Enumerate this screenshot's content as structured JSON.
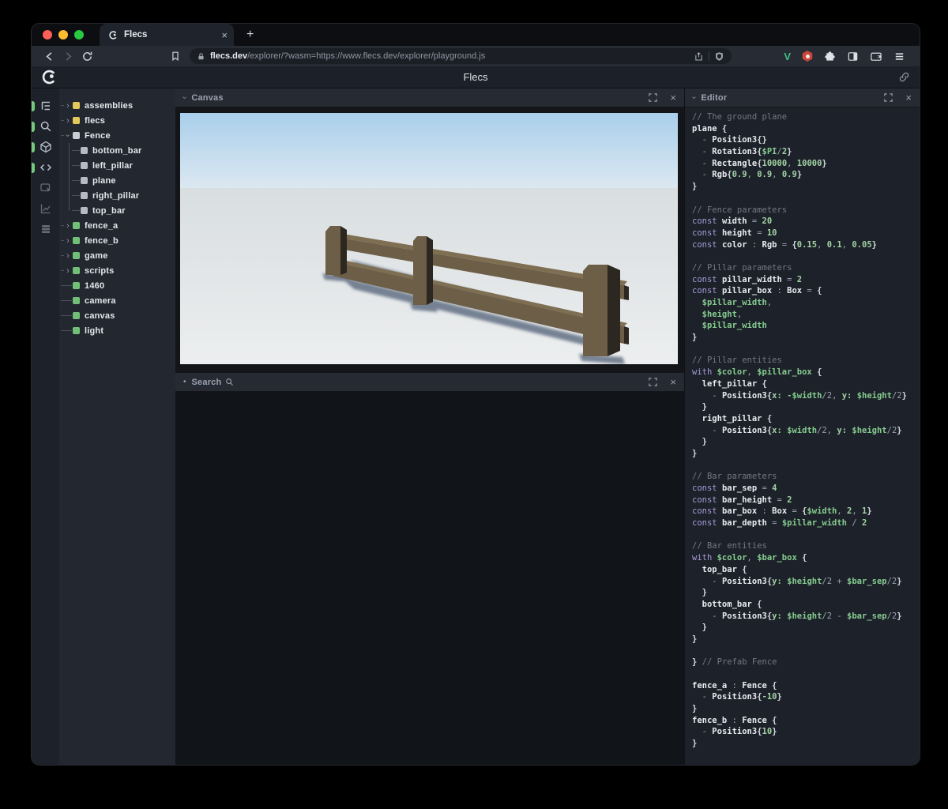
{
  "window_controls": {
    "close_color": "#ff5f57",
    "minimize_color": "#febc2e",
    "zoom_color": "#28c840"
  },
  "browser": {
    "tab": {
      "title": "Flecs"
    },
    "url": {
      "domain": "flecs.dev",
      "path": "/explorer/?wasm=https://www.flecs.dev/explorer/playground.js"
    },
    "extensions": {
      "v_label": "V",
      "v_color": "#40bd83",
      "badge_color": "#c9453c"
    }
  },
  "header": {
    "title": "Flecs"
  },
  "icons": {
    "close": "×",
    "plus": "+",
    "chevron": "›",
    "dot": "•"
  },
  "toolstrip": {
    "active_color": "#74c97c",
    "items": [
      {
        "name": "entity-tree",
        "icon": "hierarchy",
        "active": true
      },
      {
        "name": "query-search",
        "icon": "search",
        "active": true
      },
      {
        "name": "canvas-3d",
        "icon": "cube",
        "active": true
      },
      {
        "name": "script-editor",
        "icon": "code",
        "active": true
      },
      {
        "name": "inspector",
        "icon": "inspect",
        "active": false
      },
      {
        "name": "statistics",
        "icon": "chart",
        "active": false
      },
      {
        "name": "tables",
        "icon": "rows",
        "active": false
      }
    ]
  },
  "tree": {
    "colors": {
      "module": "#e3c85a",
      "prefab": "#c9ced5",
      "child": "#b4bbc3",
      "entity": "#72c077"
    },
    "items": [
      {
        "label": "assemblies",
        "kind": "module",
        "arrow": "collapsed",
        "depth": 0
      },
      {
        "label": "flecs",
        "kind": "module",
        "arrow": "collapsed",
        "depth": 0
      },
      {
        "label": "Fence",
        "kind": "prefab",
        "arrow": "expanded",
        "depth": 0
      },
      {
        "label": "bottom_bar",
        "kind": "child",
        "arrow": "child",
        "depth": 1
      },
      {
        "label": "left_pillar",
        "kind": "child",
        "arrow": "child",
        "depth": 1
      },
      {
        "label": "plane",
        "kind": "child",
        "arrow": "child",
        "depth": 1
      },
      {
        "label": "right_pillar",
        "kind": "child",
        "arrow": "child",
        "depth": 1
      },
      {
        "label": "top_bar",
        "kind": "child",
        "arrow": "child",
        "depth": 1
      },
      {
        "label": "fence_a",
        "kind": "entity",
        "arrow": "collapsed",
        "depth": 0
      },
      {
        "label": "fence_b",
        "kind": "entity",
        "arrow": "collapsed",
        "depth": 0
      },
      {
        "label": "game",
        "kind": "entity",
        "arrow": "collapsed",
        "depth": 0
      },
      {
        "label": "scripts",
        "kind": "entity",
        "arrow": "collapsed",
        "depth": 0
      },
      {
        "label": "1460",
        "kind": "entity",
        "arrow": "leaf",
        "depth": 0
      },
      {
        "label": "camera",
        "kind": "entity",
        "arrow": "leaf",
        "depth": 0
      },
      {
        "label": "canvas",
        "kind": "entity",
        "arrow": "leaf",
        "depth": 0
      },
      {
        "label": "light",
        "kind": "entity",
        "arrow": "leaf",
        "depth": 0
      }
    ]
  },
  "panels": {
    "canvas": {
      "title": "Canvas"
    },
    "search": {
      "title": "Search"
    },
    "editor": {
      "title": "Editor"
    }
  },
  "scene": {
    "sky_top": "#a9cfeb",
    "sky_horizon": "#dce8f1",
    "ground_far": "#d9dee0",
    "ground_near": "#eceeef",
    "wood_front": "#6c5e47",
    "wood_top": "#7e6e52",
    "wood_side": "#2c2720",
    "shadow": "#5d6c80"
  },
  "code": {
    "lines": [
      [
        [
          "c",
          "// The ground plane"
        ]
      ],
      [
        [
          "i",
          "plane"
        ],
        [
          "b",
          " {"
        ]
      ],
      [
        [
          "p",
          "  - "
        ],
        [
          "i",
          "Position3"
        ],
        [
          "b",
          "{}"
        ]
      ],
      [
        [
          "p",
          "  - "
        ],
        [
          "i",
          "Rotation3"
        ],
        [
          "b",
          "{"
        ],
        [
          "v",
          "$PI"
        ],
        [
          "p",
          "/"
        ],
        [
          "n",
          "2"
        ],
        [
          "b",
          "}"
        ]
      ],
      [
        [
          "p",
          "  - "
        ],
        [
          "i",
          "Rectangle"
        ],
        [
          "b",
          "{"
        ],
        [
          "n",
          "10000"
        ],
        [
          "p",
          ", "
        ],
        [
          "n",
          "10000"
        ],
        [
          "b",
          "}"
        ]
      ],
      [
        [
          "p",
          "  - "
        ],
        [
          "i",
          "Rgb"
        ],
        [
          "b",
          "{"
        ],
        [
          "n",
          "0.9"
        ],
        [
          "p",
          ", "
        ],
        [
          "n",
          "0.9"
        ],
        [
          "p",
          ", "
        ],
        [
          "n",
          "0.9"
        ],
        [
          "b",
          "}"
        ]
      ],
      [
        [
          "b",
          "}"
        ]
      ],
      [],
      [
        [
          "c",
          "// Fence parameters"
        ]
      ],
      [
        [
          "k",
          "const "
        ],
        [
          "i",
          "width"
        ],
        [
          "p",
          " = "
        ],
        [
          "n",
          "20"
        ]
      ],
      [
        [
          "k",
          "const "
        ],
        [
          "i",
          "height"
        ],
        [
          "p",
          " = "
        ],
        [
          "n",
          "10"
        ]
      ],
      [
        [
          "k",
          "const "
        ],
        [
          "i",
          "color"
        ],
        [
          "p",
          " : "
        ],
        [
          "i",
          "Rgb"
        ],
        [
          "p",
          " = "
        ],
        [
          "b",
          "{"
        ],
        [
          "n",
          "0.15"
        ],
        [
          "p",
          ", "
        ],
        [
          "n",
          "0.1"
        ],
        [
          "p",
          ", "
        ],
        [
          "n",
          "0.05"
        ],
        [
          "b",
          "}"
        ]
      ],
      [],
      [
        [
          "c",
          "// Pillar parameters"
        ]
      ],
      [
        [
          "k",
          "const "
        ],
        [
          "i",
          "pillar_width"
        ],
        [
          "p",
          " = "
        ],
        [
          "n",
          "2"
        ]
      ],
      [
        [
          "k",
          "const "
        ],
        [
          "i",
          "pillar_box"
        ],
        [
          "p",
          " : "
        ],
        [
          "i",
          "Box"
        ],
        [
          "p",
          " = "
        ],
        [
          "b",
          "{"
        ]
      ],
      [
        [
          "v",
          "  $pillar_width"
        ],
        [
          "p",
          ","
        ]
      ],
      [
        [
          "v",
          "  $height"
        ],
        [
          "p",
          ","
        ]
      ],
      [
        [
          "v",
          "  $pillar_width"
        ]
      ],
      [
        [
          "b",
          "}"
        ]
      ],
      [],
      [
        [
          "c",
          "// Pillar entities"
        ]
      ],
      [
        [
          "k",
          "with "
        ],
        [
          "v",
          "$color"
        ],
        [
          "p",
          ", "
        ],
        [
          "v",
          "$pillar_box"
        ],
        [
          "b",
          " {"
        ]
      ],
      [
        [
          "i",
          "  left_pillar"
        ],
        [
          "b",
          " {"
        ]
      ],
      [
        [
          "p",
          "    - "
        ],
        [
          "i",
          "Position3"
        ],
        [
          "b",
          "{"
        ],
        [
          "n",
          "x:"
        ],
        [
          "p",
          " "
        ],
        [
          "v",
          "-$width"
        ],
        [
          "p",
          "/2, "
        ],
        [
          "n",
          "y:"
        ],
        [
          "p",
          " "
        ],
        [
          "v",
          "$height"
        ],
        [
          "p",
          "/2"
        ],
        [
          "b",
          "}"
        ]
      ],
      [
        [
          "b",
          "  }"
        ]
      ],
      [
        [
          "i",
          "  right_pillar"
        ],
        [
          "b",
          " {"
        ]
      ],
      [
        [
          "p",
          "    - "
        ],
        [
          "i",
          "Position3"
        ],
        [
          "b",
          "{"
        ],
        [
          "n",
          "x:"
        ],
        [
          "p",
          " "
        ],
        [
          "v",
          "$width"
        ],
        [
          "p",
          "/2, "
        ],
        [
          "n",
          "y:"
        ],
        [
          "p",
          " "
        ],
        [
          "v",
          "$height"
        ],
        [
          "p",
          "/2"
        ],
        [
          "b",
          "}"
        ]
      ],
      [
        [
          "b",
          "  }"
        ]
      ],
      [
        [
          "b",
          "}"
        ]
      ],
      [],
      [
        [
          "c",
          "// Bar parameters"
        ]
      ],
      [
        [
          "k",
          "const "
        ],
        [
          "i",
          "bar_sep"
        ],
        [
          "p",
          " = "
        ],
        [
          "n",
          "4"
        ]
      ],
      [
        [
          "k",
          "const "
        ],
        [
          "i",
          "bar_height"
        ],
        [
          "p",
          " = "
        ],
        [
          "n",
          "2"
        ]
      ],
      [
        [
          "k",
          "const "
        ],
        [
          "i",
          "bar_box"
        ],
        [
          "p",
          " : "
        ],
        [
          "i",
          "Box"
        ],
        [
          "p",
          " = "
        ],
        [
          "b",
          "{"
        ],
        [
          "v",
          "$width"
        ],
        [
          "p",
          ", "
        ],
        [
          "n",
          "2"
        ],
        [
          "p",
          ", "
        ],
        [
          "n",
          "1"
        ],
        [
          "b",
          "}"
        ]
      ],
      [
        [
          "k",
          "const "
        ],
        [
          "i",
          "bar_depth"
        ],
        [
          "p",
          " = "
        ],
        [
          "v",
          "$pillar_width"
        ],
        [
          "p",
          " / "
        ],
        [
          "n",
          "2"
        ]
      ],
      [],
      [
        [
          "c",
          "// Bar entities"
        ]
      ],
      [
        [
          "k",
          "with "
        ],
        [
          "v",
          "$color"
        ],
        [
          "p",
          ", "
        ],
        [
          "v",
          "$bar_box"
        ],
        [
          "b",
          " {"
        ]
      ],
      [
        [
          "i",
          "  top_bar"
        ],
        [
          "b",
          " {"
        ]
      ],
      [
        [
          "p",
          "    - "
        ],
        [
          "i",
          "Position3"
        ],
        [
          "b",
          "{"
        ],
        [
          "n",
          "y:"
        ],
        [
          "p",
          " "
        ],
        [
          "v",
          "$height"
        ],
        [
          "p",
          "/2 + "
        ],
        [
          "v",
          "$bar_sep"
        ],
        [
          "p",
          "/2"
        ],
        [
          "b",
          "}"
        ]
      ],
      [
        [
          "b",
          "  }"
        ]
      ],
      [
        [
          "i",
          "  bottom_bar"
        ],
        [
          "b",
          " {"
        ]
      ],
      [
        [
          "p",
          "    - "
        ],
        [
          "i",
          "Position3"
        ],
        [
          "b",
          "{"
        ],
        [
          "n",
          "y:"
        ],
        [
          "p",
          " "
        ],
        [
          "v",
          "$height"
        ],
        [
          "p",
          "/2 - "
        ],
        [
          "v",
          "$bar_sep"
        ],
        [
          "p",
          "/2"
        ],
        [
          "b",
          "}"
        ]
      ],
      [
        [
          "b",
          "  }"
        ]
      ],
      [
        [
          "b",
          "}"
        ]
      ],
      [],
      [
        [
          "b",
          "} "
        ],
        [
          "c",
          "// Prefab Fence"
        ]
      ],
      [],
      [
        [
          "i",
          "fence_a"
        ],
        [
          "p",
          " : "
        ],
        [
          "i",
          "Fence"
        ],
        [
          "b",
          " {"
        ]
      ],
      [
        [
          "p",
          "  - "
        ],
        [
          "i",
          "Position3"
        ],
        [
          "b",
          "{"
        ],
        [
          "n",
          "-10"
        ],
        [
          "b",
          "}"
        ]
      ],
      [
        [
          "b",
          "}"
        ]
      ],
      [
        [
          "i",
          "fence_b"
        ],
        [
          "p",
          " : "
        ],
        [
          "i",
          "Fence"
        ],
        [
          "b",
          " {"
        ]
      ],
      [
        [
          "p",
          "  - "
        ],
        [
          "i",
          "Position3"
        ],
        [
          "b",
          "{"
        ],
        [
          "n",
          "10"
        ],
        [
          "b",
          "}"
        ]
      ],
      [
        [
          "b",
          "}"
        ]
      ]
    ]
  }
}
